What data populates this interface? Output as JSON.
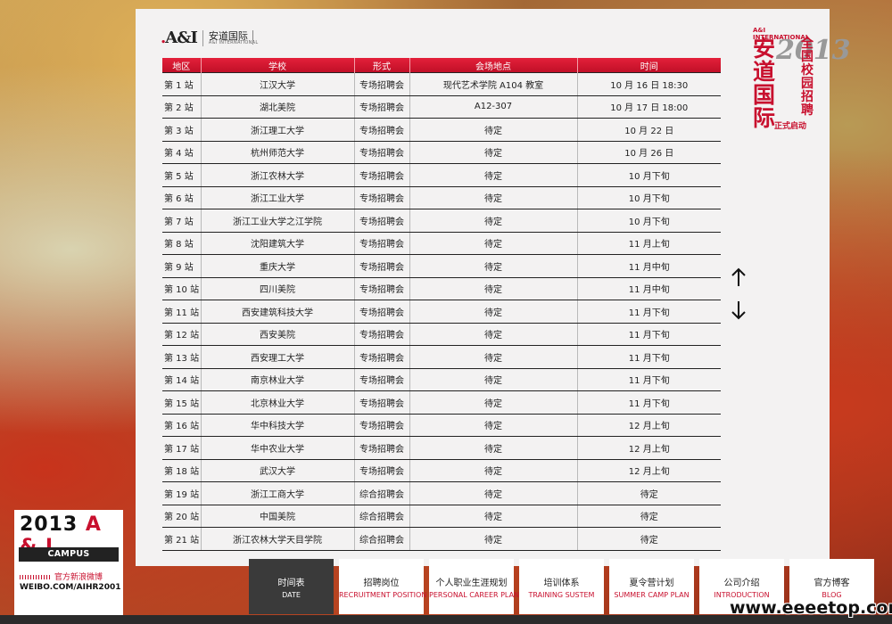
{
  "logo": {
    "mark": "A&I",
    "name_cn": "安道国际",
    "name_en": "A&I INTERNATIONAL"
  },
  "table": {
    "headers": [
      "地区",
      "学校",
      "形式",
      "会场地点",
      "时间"
    ],
    "rows": [
      [
        "第 1 站",
        "江汉大学",
        "专场招聘会",
        "现代艺术学院 A104 教室",
        "10 月 16 日 18:30"
      ],
      [
        "第 2 站",
        "湖北美院",
        "专场招聘会",
        "A12-307",
        "10 月 17 日 18:00"
      ],
      [
        "第 3 站",
        "浙江理工大学",
        "专场招聘会",
        "待定",
        "10 月 22 日"
      ],
      [
        "第 4 站",
        "杭州师范大学",
        "专场招聘会",
        "待定",
        "10 月 26 日"
      ],
      [
        "第 5 站",
        "浙江农林大学",
        "专场招聘会",
        "待定",
        "10 月下旬"
      ],
      [
        "第 6 站",
        "浙江工业大学",
        "专场招聘会",
        "待定",
        "10 月下旬"
      ],
      [
        "第 7 站",
        "浙江工业大学之江学院",
        "专场招聘会",
        "待定",
        "10 月下旬"
      ],
      [
        "第 8 站",
        "沈阳建筑大学",
        "专场招聘会",
        "待定",
        "11 月上旬"
      ],
      [
        "第 9 站",
        "重庆大学",
        "专场招聘会",
        "待定",
        "11 月中旬"
      ],
      [
        "第 10 站",
        "四川美院",
        "专场招聘会",
        "待定",
        "11 月中旬"
      ],
      [
        "第 11 站",
        "西安建筑科技大学",
        "专场招聘会",
        "待定",
        "11 月下旬"
      ],
      [
        "第 12 站",
        "西安美院",
        "专场招聘会",
        "待定",
        "11 月下旬"
      ],
      [
        "第 13 站",
        "西安理工大学",
        "专场招聘会",
        "待定",
        "11 月下旬"
      ],
      [
        "第 14 站",
        "南京林业大学",
        "专场招聘会",
        "待定",
        "11 月下旬"
      ],
      [
        "第 15 站",
        "北京林业大学",
        "专场招聘会",
        "待定",
        "11 月下旬"
      ],
      [
        "第 16 站",
        "华中科技大学",
        "专场招聘会",
        "待定",
        "12 月上旬"
      ],
      [
        "第 17 站",
        "华中农业大学",
        "专场招聘会",
        "待定",
        "12 月上旬"
      ],
      [
        "第 18 站",
        "武汉大学",
        "专场招聘会",
        "待定",
        "12 月上旬"
      ],
      [
        "第 19 站",
        "浙江工商大学",
        "综合招聘会",
        "待定",
        "待定"
      ],
      [
        "第 20 站",
        "中国美院",
        "综合招聘会",
        "待定",
        "待定"
      ],
      [
        "第 21 站",
        "浙江农林大学天目学院",
        "综合招聘会",
        "待定",
        "待定"
      ]
    ]
  },
  "scroll": {
    "up_icon": "arrow-up-icon",
    "down_icon": "arrow-down-icon"
  },
  "badge": {
    "en": "A&I INTERNATIONAL",
    "cn": "安道国际",
    "year": "2013",
    "title": "全国校园招聘",
    "launch": "正式启动"
  },
  "corner": {
    "year": "2013",
    "brand": "A & I",
    "campus": "CAMPUS RECRUITING",
    "weibo": "官方新浪微博",
    "url": "WEIBO.COM/AIHR2001"
  },
  "nav": [
    {
      "cn": "时间表",
      "en": "DATE",
      "active": true
    },
    {
      "cn": "招聘岗位",
      "en": "RECRUITMENT POSITION"
    },
    {
      "cn": "个人职业生涯规划",
      "en": "PERSONAL CAREER PLAN"
    },
    {
      "cn": "培训体系",
      "en": "TRAINING SUSTEM"
    },
    {
      "cn": "夏令营计划",
      "en": "SUMMER CAMP PLAN"
    },
    {
      "cn": "公司介绍",
      "en": "INTRODUCTION"
    },
    {
      "cn": "官方博客",
      "en": "BLOG"
    }
  ],
  "watermark": "www.eeeetop.com",
  "colors": {
    "accent": "#c8102e",
    "header_red": "#e3203a",
    "nav_active": "#3a3a3a"
  }
}
